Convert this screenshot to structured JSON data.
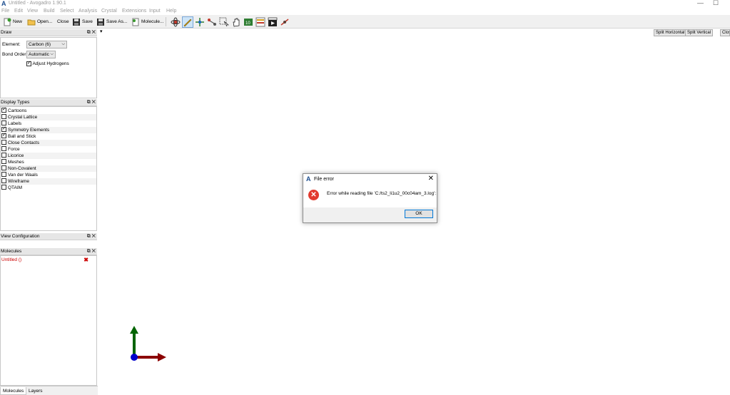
{
  "window": {
    "title": "Untitled - Avogadro 1.90.1",
    "logo": "A",
    "minimize": "—",
    "maximize": "☐"
  },
  "menu": [
    "File",
    "Edit",
    "View",
    "Build",
    "Select",
    "Analysis",
    "Crystal",
    "Extensions",
    "Input",
    "Help"
  ],
  "toolbar": {
    "new_label": "New",
    "open_label": "Open...",
    "close_label": "Close",
    "save_label": "Save",
    "save_as_label": "Save As...",
    "molecule_label": "Molecule...",
    "tools": [
      "navigate-tool-icon",
      "draw-tool-icon",
      "bond-centric-icon",
      "manipulate-icon",
      "select-icon",
      "hand-icon",
      "measure-icon",
      "align-icon",
      "animation-icon",
      "auto-optimize-icon"
    ]
  },
  "draw_panel": {
    "title": "Draw",
    "element_label": "Element:",
    "element_value": "Carbon (6)",
    "bond_order_label": "Bond Order:",
    "bond_order_value": "Automatic",
    "adjust_h_label": "Adjust Hydrogens",
    "adjust_h_checked": true
  },
  "display_types": {
    "title": "Display Types",
    "items": [
      {
        "label": "Cartoons",
        "checked": true
      },
      {
        "label": "Crystal Lattice",
        "checked": false
      },
      {
        "label": "Labels",
        "checked": false
      },
      {
        "label": "Symmetry Elements",
        "checked": true
      },
      {
        "label": "Ball and Stick",
        "checked": true
      },
      {
        "label": "Close Contacts",
        "checked": false
      },
      {
        "label": "Force",
        "checked": false
      },
      {
        "label": "Licorice",
        "checked": false
      },
      {
        "label": "Meshes",
        "checked": false
      },
      {
        "label": "Non-Covalent",
        "checked": false
      },
      {
        "label": "Van der Waals",
        "checked": false
      },
      {
        "label": "Wireframe",
        "checked": false
      },
      {
        "label": "QTAIM",
        "checked": false
      }
    ]
  },
  "view_config": {
    "title": "View Configuration"
  },
  "molecules_panel": {
    "title": "Molecules",
    "items": [
      {
        "label": "Untitled ()"
      }
    ],
    "item_color": "#cc0000"
  },
  "dock_buttons": "⧉ ✕",
  "bottom_tabs": [
    "Molecules",
    "Layers"
  ],
  "viewport": {
    "tab_marker": "▾",
    "split_horizontal": "Split Horizontal",
    "split_vertical": "Split Vertical",
    "close": "Close"
  },
  "dialog": {
    "title": "File error",
    "message": "Error while reading file 'C:/ts2_li1u2_00c04am_3.log':",
    "ok_label": "OK",
    "close_glyph": "✕",
    "error_glyph": "✕"
  },
  "colors": {
    "axis_x": "#8b0000",
    "axis_y": "#006400",
    "axis_origin": "#0000cc",
    "error_red": "#e23a2e"
  }
}
